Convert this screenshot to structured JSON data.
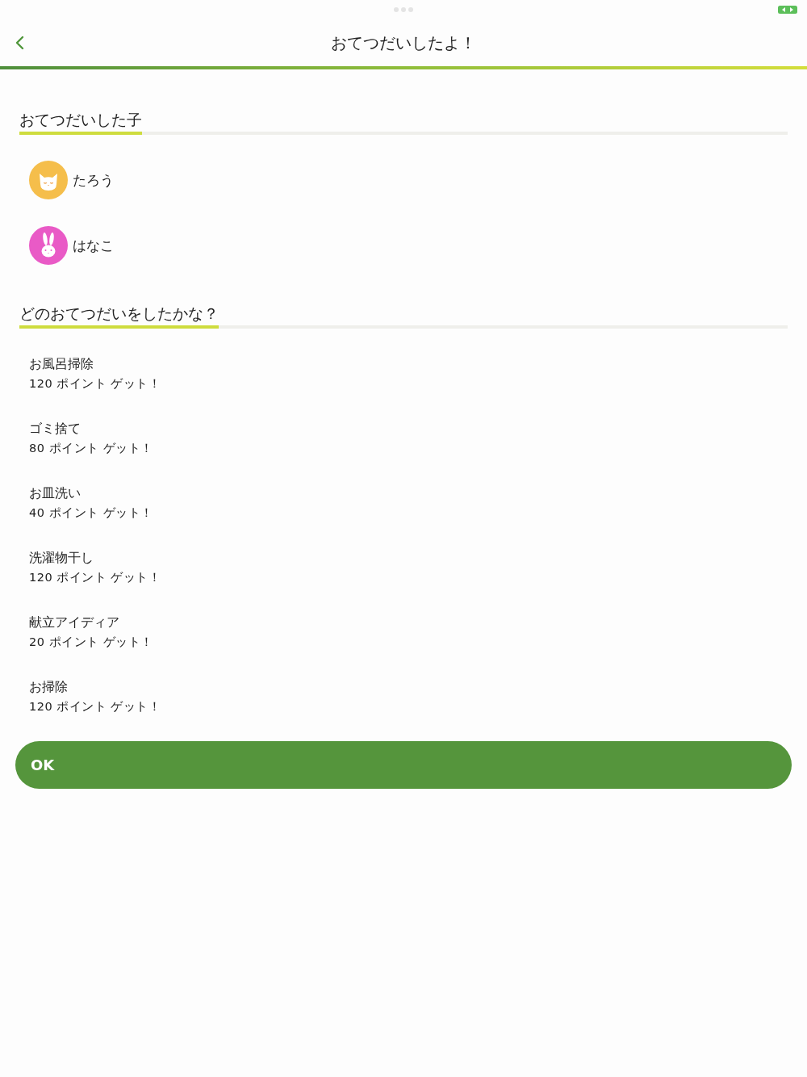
{
  "header": {
    "title": "おてつだいしたよ！"
  },
  "helpers_section": {
    "heading": "おてつだいした子",
    "helpers": [
      {
        "name": "たろう",
        "kind": "cat",
        "color": "#f5be4b"
      },
      {
        "name": "はなこ",
        "kind": "rabbit",
        "color": "#e95ac6"
      }
    ]
  },
  "chores_section": {
    "heading": "どのおてつだいをしたかな？",
    "chores": [
      {
        "name": "お風呂掃除",
        "points": "120 ポイント ゲット！"
      },
      {
        "name": "ゴミ捨て",
        "points": "80 ポイント ゲット！"
      },
      {
        "name": "お皿洗い",
        "points": "40 ポイント ゲット！"
      },
      {
        "name": "洗濯物干し",
        "points": "120 ポイント ゲット！"
      },
      {
        "name": "献立アイディア",
        "points": "20 ポイント ゲット！"
      },
      {
        "name": "お掃除",
        "points": "120 ポイント ゲット！"
      }
    ]
  },
  "ok_button": {
    "label": "OK"
  }
}
